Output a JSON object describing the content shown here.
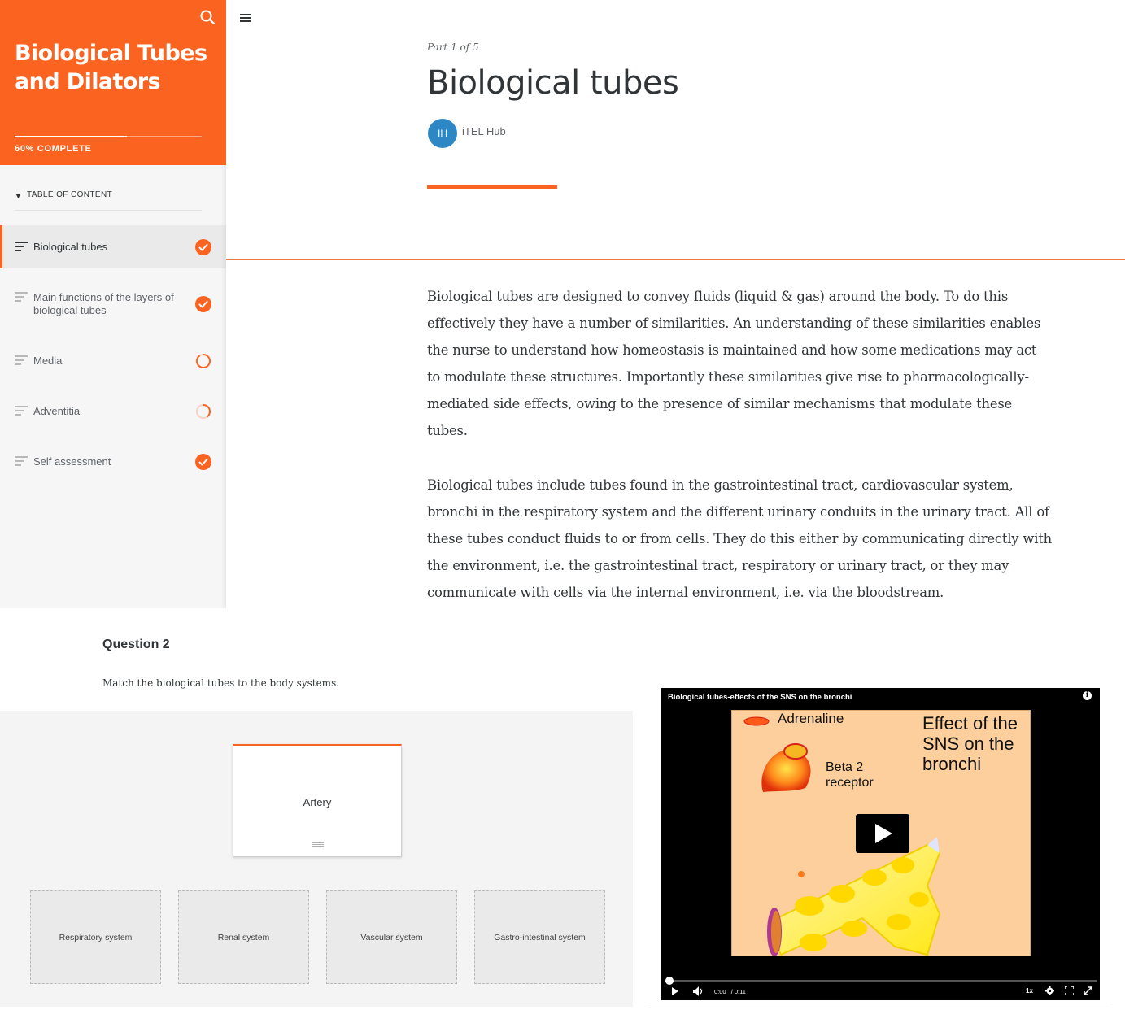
{
  "course": {
    "title": "Biological Tubes and Dilators",
    "progress_percent": 60,
    "progress_label": "60% COMPLETE",
    "toc_label": "TABLE OF CONTENT",
    "lessons": [
      {
        "label": "Biological tubes",
        "status": "complete",
        "active": true
      },
      {
        "label": "Main functions of the layers of biological tubes",
        "status": "complete",
        "active": false
      },
      {
        "label": "Media",
        "status": "in-progress",
        "progress": 0.9,
        "active": false
      },
      {
        "label": "Adventitia",
        "status": "in-progress",
        "progress": 0.4,
        "active": false
      },
      {
        "label": "Self assessment",
        "status": "complete",
        "active": false
      }
    ]
  },
  "lesson": {
    "part_label": "Part 1 of 5",
    "title": "Biological tubes",
    "author_initials": "IH",
    "author_name": "iTEL Hub",
    "paragraphs": [
      "Biological tubes are designed to convey fluids (liquid & gas) around the body.  To do this effectively they have a number of similarities.   An understanding of these similarities enables the nurse to understand how homeostasis is maintained and how some medications may act to modulate these structures.  Importantly these similarities give rise to pharmacologically-mediated side effects, owing to the presence of similar mechanisms that modulate these tubes.",
      "Biological tubes include tubes found in the gastrointestinal tract, cardiovascular system, bronchi in the respiratory system and the different urinary conduits in the urinary tract.  All of these tubes conduct fluids to or from cells.  They do this either by communicating directly with the environment, i.e. the gastrointestinal tract, respiratory or urinary tract, or they may communicate with cells via the internal environment, i.e. via the bloodstream."
    ]
  },
  "question": {
    "title": "Question 2",
    "prompt": "Match the biological tubes to the body systems.",
    "card": "Artery",
    "drop_targets": [
      "Respiratory system",
      "Renal system",
      "Vascular system",
      "Gastro-intestinal system"
    ]
  },
  "video": {
    "title": "Biological tubes-effects of the SNS on the bronchi",
    "slide": {
      "adrenaline": "Adrenaline",
      "receptor_line1": "Beta 2",
      "receptor_line2": "receptor",
      "heading_line1": "Effect of the",
      "heading_line2": "SNS on the",
      "heading_line3": "bronchi"
    },
    "current_time": "0:00",
    "duration": "/ 0:11",
    "speed": "1x",
    "played_fraction": 0.0
  },
  "colors": {
    "accent": "#fb6420",
    "avatar": "#2d87c4",
    "sidebar_bg": "#f6f6f6",
    "text": "#313537"
  },
  "icons": [
    "search-icon",
    "menu-icon",
    "lesson-icon",
    "check-icon",
    "progress-ring-icon",
    "play-icon",
    "volume-icon",
    "settings-icon",
    "fullscreen-icon",
    "info-icon"
  ]
}
